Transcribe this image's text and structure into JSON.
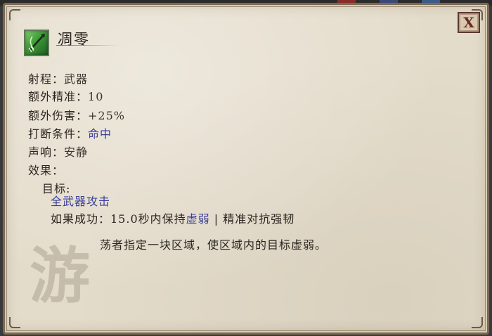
{
  "tooltip": {
    "title": "凋零",
    "icon": "bow-arrow-icon",
    "close_label": "X",
    "stats": [
      {
        "label": "射程：",
        "value": "武器",
        "value_is_link": false
      },
      {
        "label": "额外精准：",
        "value": "10",
        "value_is_link": false
      },
      {
        "label": "额外伤害：",
        "value": "+25%",
        "value_is_link": false
      },
      {
        "label": "打断条件：",
        "value": "命中",
        "value_is_link": true
      },
      {
        "label": "声响：",
        "value": "安静",
        "value_is_link": false
      }
    ],
    "effects_label": "效果：",
    "target_label": "目标:",
    "target_value": "全武器攻击",
    "on_success_label": "如果成功：15.0秒内保持",
    "on_success_link": "虚弱",
    "on_success_rest": "| 精准对抗强韧",
    "description": "荡者指定一块区域，使区域内的目标虚弱。",
    "class_glyph": "游"
  },
  "colors": {
    "parchment": "#e4dccb",
    "link": "#3b3f9a",
    "text": "#2a2520",
    "close_border": "#5a3a2e"
  }
}
